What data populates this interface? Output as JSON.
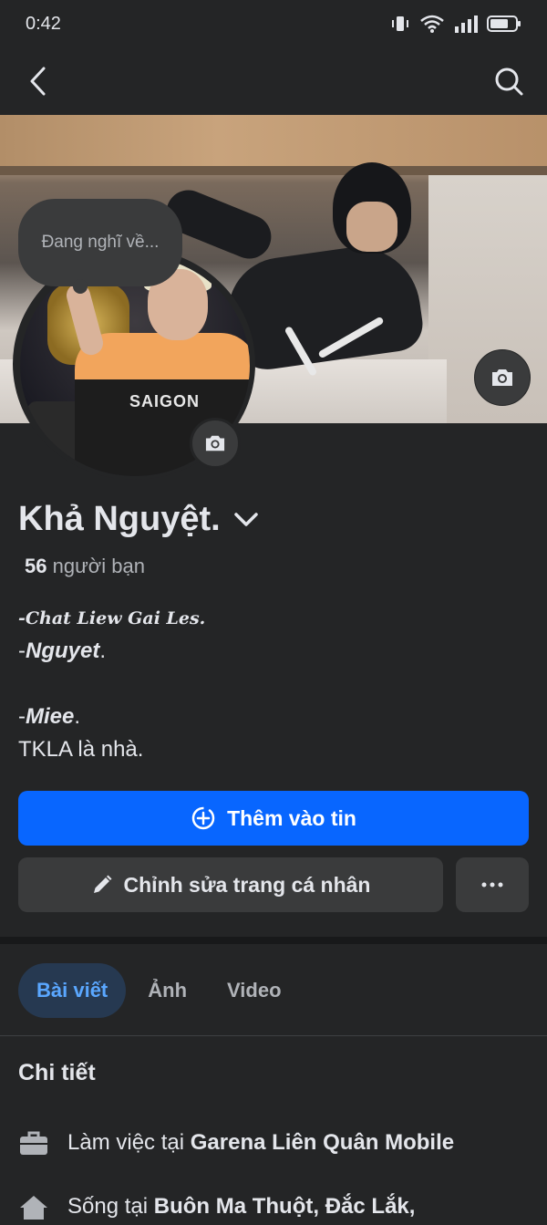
{
  "status_bar": {
    "time": "0:42"
  },
  "profile": {
    "thought_placeholder": "Đang nghĩ về...",
    "name": "Khả Nguyệt.",
    "friends_count": "56",
    "friends_label": "người bạn",
    "bio": {
      "line1": "-Chat Liew Gai Les.",
      "line2_prefix": "-",
      "line2_bold": "Nguyet",
      "line2_suffix": ".",
      "line3_prefix": "-",
      "line3_bold": "Miee",
      "line3_suffix": ".",
      "line4": "TKLA là nhà."
    },
    "avatar_text": "SAIGON"
  },
  "actions": {
    "add_story": "Thêm vào tin",
    "edit_profile": "Chỉnh sửa trang cá nhân"
  },
  "tabs": [
    {
      "label": "Bài viết",
      "active": true
    },
    {
      "label": "Ảnh",
      "active": false
    },
    {
      "label": "Video",
      "active": false
    }
  ],
  "details": {
    "title": "Chi tiết",
    "work_prefix": "Làm việc tại",
    "work_place": "Garena Liên Quân Mobile",
    "live_prefix": "Sống tại",
    "live_place": "Buôn Ma Thuột, Đắc Lắk,"
  },
  "colors": {
    "accent": "#0866ff",
    "background": "#242526",
    "button": "#3a3b3c"
  },
  "icons": [
    "back-icon",
    "search-icon",
    "camera-icon",
    "chevron-down-icon",
    "add-story-icon",
    "pencil-icon",
    "more-icon",
    "briefcase-icon",
    "home-icon"
  ]
}
